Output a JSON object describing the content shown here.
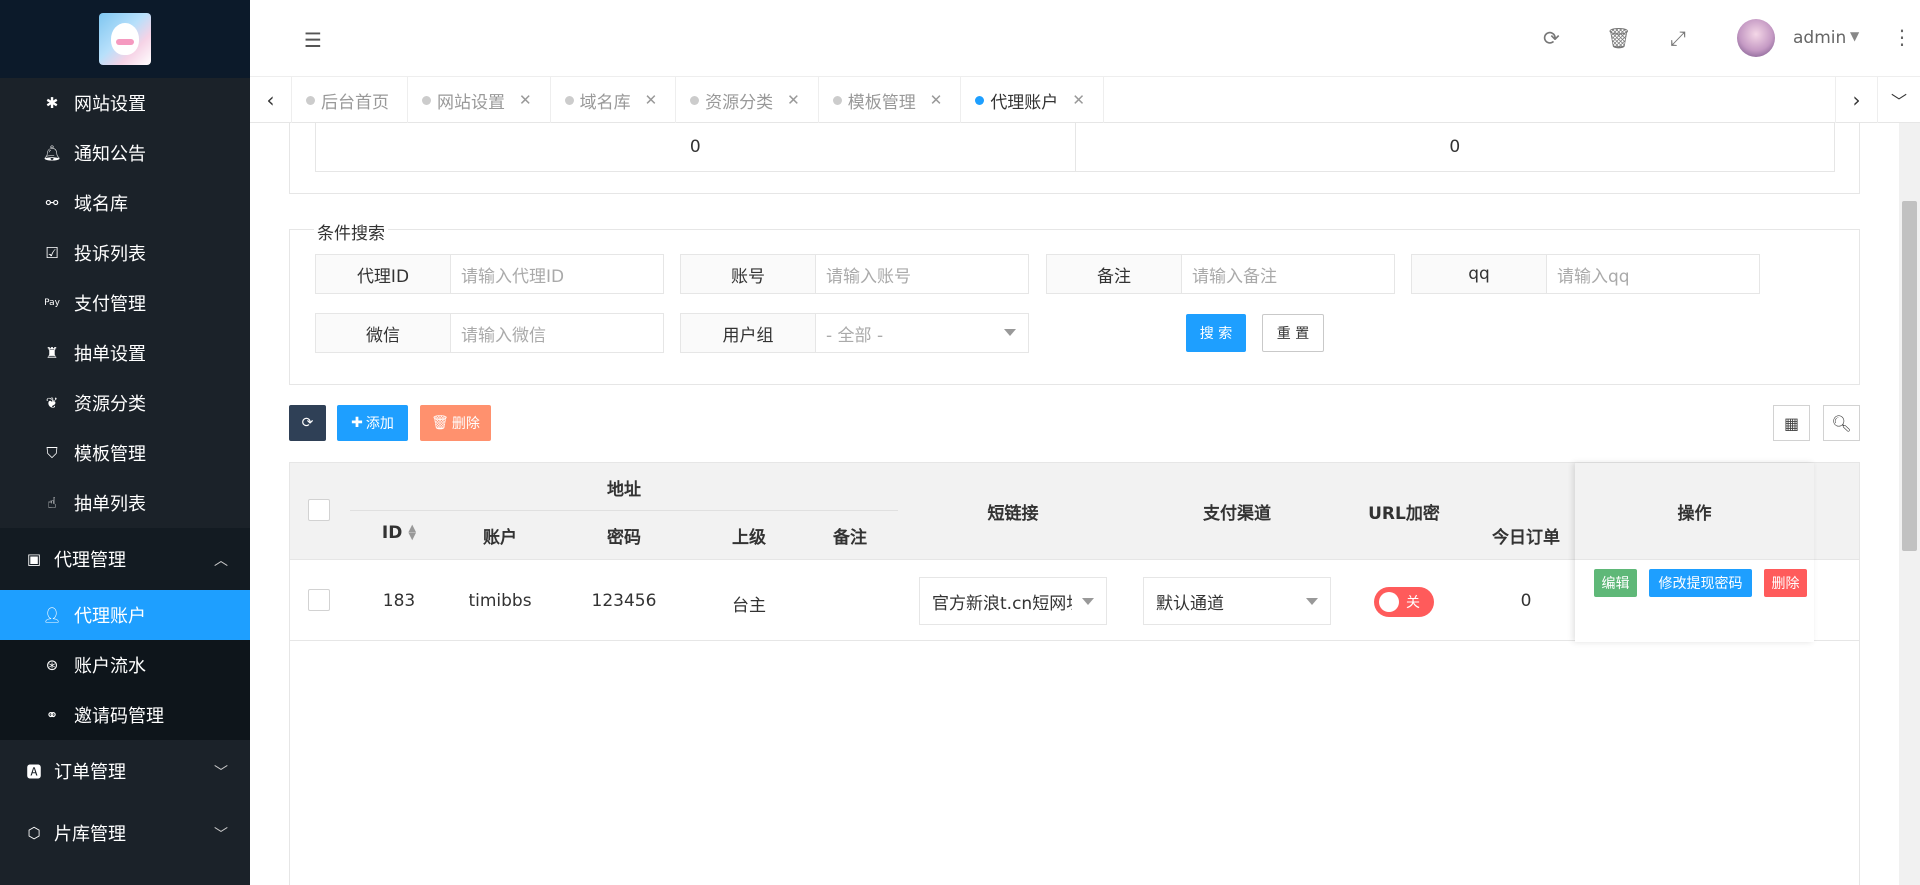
{
  "sidebar": {
    "items": [
      {
        "label": "网站设置",
        "icon": "asterisk-icon"
      },
      {
        "label": "通知公告",
        "icon": "bell-icon"
      },
      {
        "label": "域名库",
        "icon": "link-icon"
      },
      {
        "label": "投诉列表",
        "icon": "check-square-icon"
      },
      {
        "label": "支付管理",
        "icon": "paypal-icon"
      },
      {
        "label": "抽单设置",
        "icon": "users-icon"
      },
      {
        "label": "资源分类",
        "icon": "leaf-icon"
      },
      {
        "label": "模板管理",
        "icon": "html5-icon"
      },
      {
        "label": "抽单列表",
        "icon": "hand-icon"
      }
    ],
    "group_agent": "代理管理",
    "sub_items": [
      {
        "label": "代理账户",
        "icon": "user-icon"
      },
      {
        "label": "账户流水",
        "icon": "universal-access-icon"
      },
      {
        "label": "邀请码管理",
        "icon": "handshake-icon"
      }
    ],
    "group_order": "订单管理",
    "group_library": "片库管理"
  },
  "header": {
    "user": "admin"
  },
  "tabs": [
    {
      "label": "后台首页",
      "closable": false
    },
    {
      "label": "网站设置",
      "closable": true
    },
    {
      "label": "域名库",
      "closable": true
    },
    {
      "label": "资源分类",
      "closable": true
    },
    {
      "label": "模板管理",
      "closable": true
    },
    {
      "label": "代理账户",
      "closable": true,
      "active": true
    }
  ],
  "stats": [
    "0",
    "0"
  ],
  "search": {
    "legend": "条件搜索",
    "agent_id_label": "代理ID",
    "agent_id_placeholder": "请输入代理ID",
    "account_label": "账号",
    "account_placeholder": "请输入账号",
    "note_label": "备注",
    "note_placeholder": "请输入备注",
    "qq_label": "qq",
    "qq_placeholder": "请输入qq",
    "wechat_label": "微信",
    "wechat_placeholder": "请输入微信",
    "group_label": "用户组",
    "group_value": "- 全部 -",
    "search_btn": "搜 索",
    "reset_btn": "重 置"
  },
  "toolbar": {
    "add_label": "添加",
    "delete_label": "删除"
  },
  "table": {
    "header_address": "地址",
    "headers": {
      "id": "ID",
      "account": "账户",
      "password": "密码",
      "parent": "上级",
      "note": "备注",
      "short_link": "短链接",
      "pay_channel": "支付渠道",
      "url_encrypt": "URL加密",
      "today_orders": "今日订单",
      "actions": "操作"
    },
    "rows": [
      {
        "id": "183",
        "account": "timibbs",
        "password": "123456",
        "parent": "台主",
        "note": "",
        "short_link": "官方新浪t.cn短网址",
        "pay_channel": "默认通道",
        "url_encrypt": "关",
        "today_orders": "0",
        "actions": {
          "edit": "编辑",
          "change_pwd": "修改提现密码",
          "delete": "删除"
        }
      }
    ]
  },
  "colors": {
    "sidebar_bg": "#1b2229",
    "active": "#1e9fff",
    "danger": "#ff5b5b",
    "success": "#5fb878"
  }
}
